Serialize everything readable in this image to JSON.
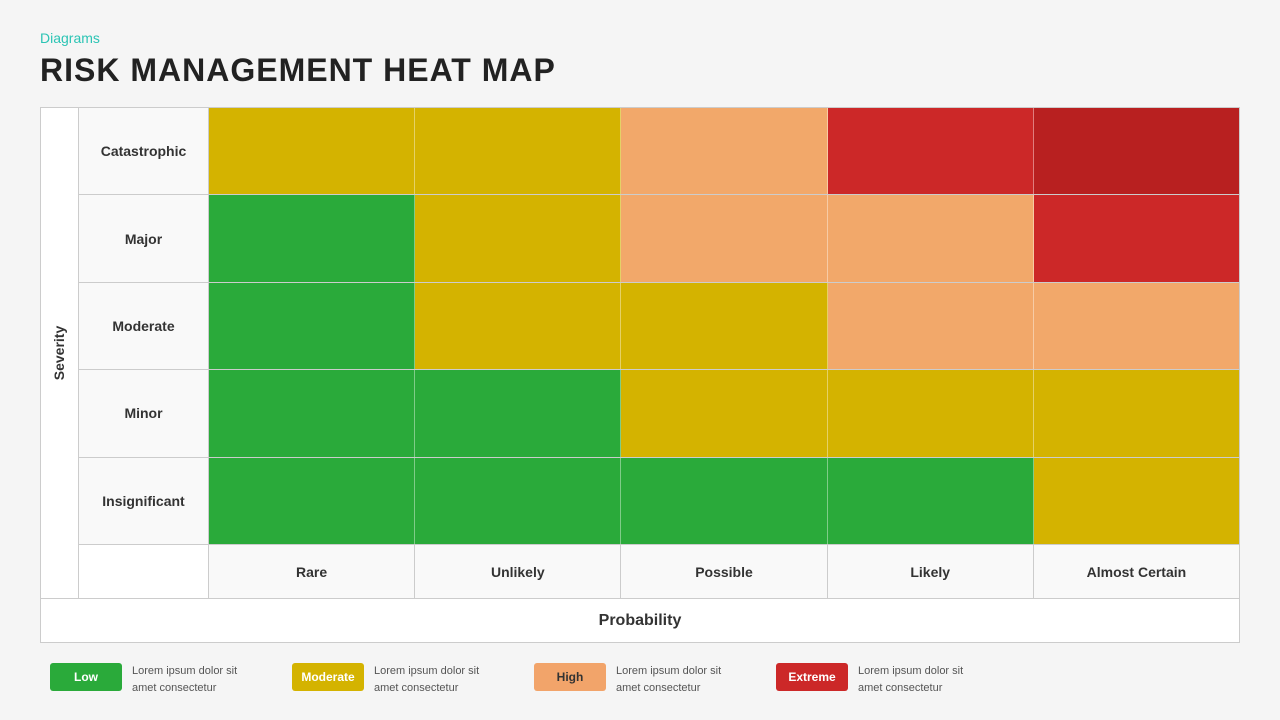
{
  "page": {
    "category": "Diagrams",
    "title": "RISK MANAGEMENT HEAT MAP"
  },
  "matrix": {
    "severity_label": "Severity",
    "probability_label": "Probability",
    "row_labels": [
      "Catastrophic",
      "Major",
      "Moderate",
      "Minor",
      "Insignificant"
    ],
    "col_labels": [
      "Rare",
      "Unlikely",
      "Possible",
      "Likely",
      "Almost Certain"
    ]
  },
  "legend": [
    {
      "badge": "Low",
      "text": "Lorem ipsum dolor sit amet consectetur",
      "class": "badge-low"
    },
    {
      "badge": "Moderate",
      "text": "Lorem ipsum dolor sit amet consectetur",
      "class": "badge-moderate"
    },
    {
      "badge": "High",
      "text": "Lorem ipsum dolor sit amet consectetur",
      "class": "badge-high"
    },
    {
      "badge": "Extreme",
      "text": "Lorem ipsum dolor sit amet consectetur",
      "class": "badge-extreme"
    }
  ]
}
